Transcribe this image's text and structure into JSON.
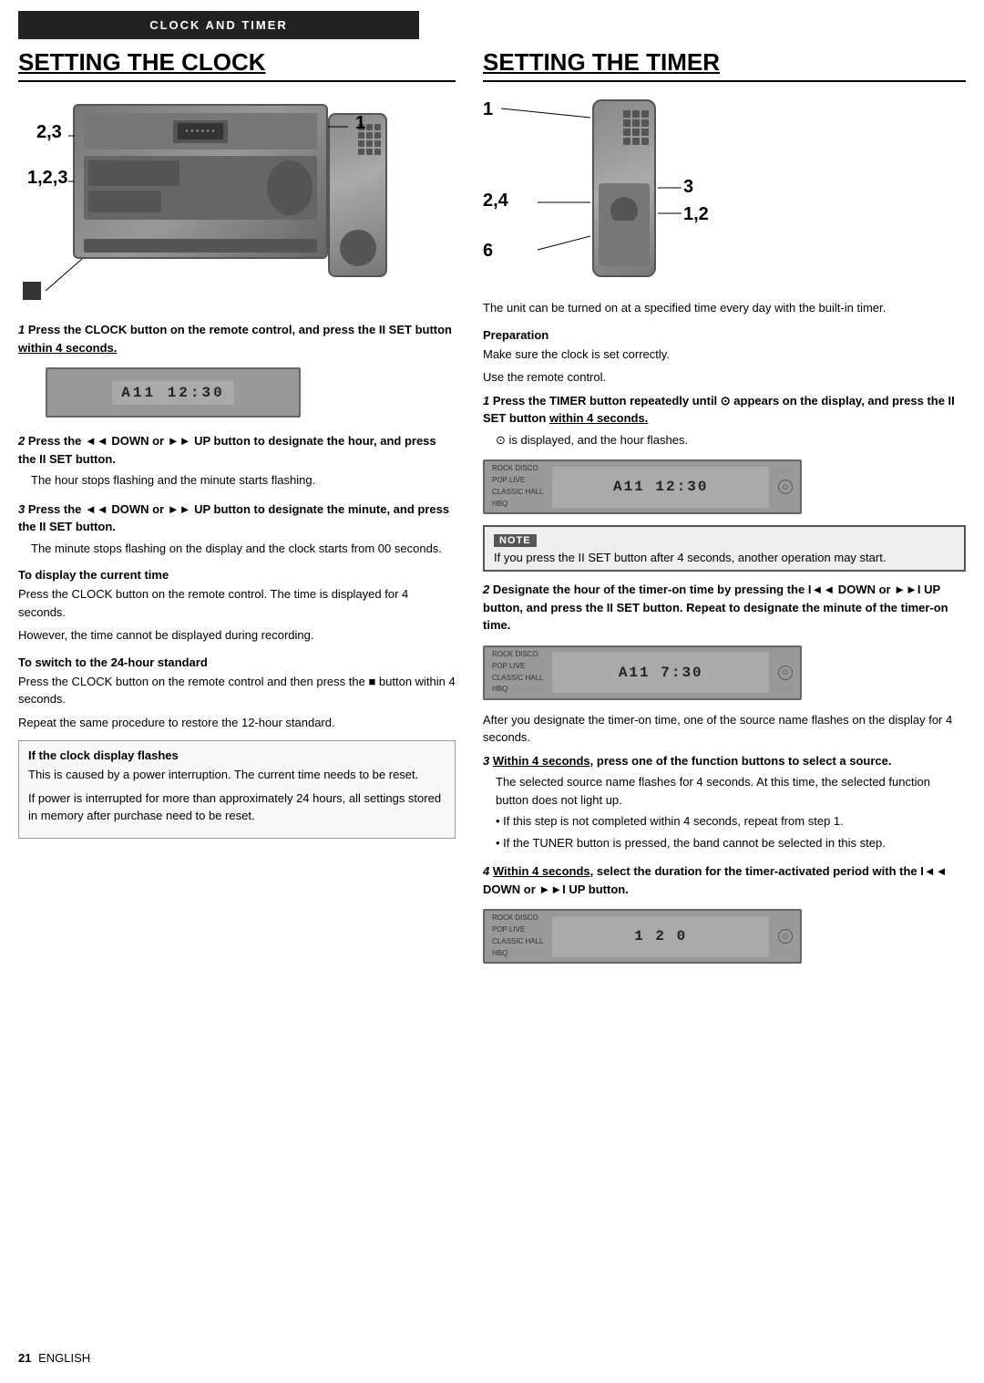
{
  "header": {
    "label": "CLOCK AND TIMER"
  },
  "left": {
    "section_title": "SETTING THE CLOCK",
    "device_labels": {
      "label_23": "2,3",
      "label_123": "1,2,3",
      "label_1": "1"
    },
    "step1": {
      "number": "1",
      "bold_text": "Press the CLOCK button on the remote control, and press the II SET button ",
      "underline_text": "within 4 seconds."
    },
    "display1": "A11 12:30",
    "step2": {
      "number": "2",
      "bold_text": "Press the ◄◄ DOWN or ►► UP button to designate the hour, and press the II SET button.",
      "sub_text": "The hour stops flashing and the minute starts flashing."
    },
    "step3": {
      "number": "3",
      "bold_text": "Press the ◄◄ DOWN or ►► UP button to designate the minute, and press the II SET button.",
      "sub_text": "The minute stops flashing on the display and the clock starts from 00 seconds."
    },
    "subsection1": {
      "title": "To display the current time",
      "text1": "Press the CLOCK button on the remote control.  The time is displayed for 4 seconds.",
      "text2": "However, the time cannot be displayed during recording."
    },
    "subsection2": {
      "title": "To switch to the 24-hour standard",
      "text1": "Press the CLOCK button on the remote control and then press the ■ button within 4 seconds.",
      "text2": "Repeat the same procedure to restore the 12-hour standard."
    },
    "box_note": {
      "title": "If the clock display flashes",
      "text1": "This is caused by a power interruption. The current time needs to be reset.",
      "text2": "If power is interrupted for more than approximately 24 hours, all settings stored in memory after purchase need to be reset."
    }
  },
  "right": {
    "section_title": "SETTING THE TIMER",
    "device_labels": {
      "label_1": "1",
      "label_24": "2,4",
      "label_3": "3",
      "label_12": "1,2",
      "label_6": "6"
    },
    "intro_text": "The unit can be turned on at a specified time every day with the built-in timer.",
    "preparation": {
      "title": "Preparation",
      "text": "Make sure the clock is set correctly."
    },
    "use_remote": "Use the remote control.",
    "step1": {
      "number": "1",
      "bold_text": "Press the TIMER button repeatedly until ⊙ appears on the display, and press the II SET button ",
      "underline_text": "within 4 seconds.",
      "sub_text": "⊙ is displayed, and the hour flashes."
    },
    "note_box": {
      "text": "If you press the II SET button after 4 seconds, another operation may start."
    },
    "step2": {
      "number": "2",
      "bold_text": "Designate the hour of the timer-on time by pressing the I◄◄ DOWN or ►►I UP button, and press the II SET button. Repeat to designate the minute of the timer-on time."
    },
    "display2": "A11  7:30",
    "after_step2_text": "After you designate the timer-on time, one of the source name flashes on the display for 4 seconds.",
    "step3": {
      "number": "3",
      "bold_prefix": "Within 4 seconds,",
      "bold_text": " press one of the function buttons to select a source.",
      "sub_text1": "The selected source name flashes for 4 seconds. At this time, the selected function button does not light up.",
      "bullet1": "If this step is not completed within 4 seconds, repeat from step 1.",
      "bullet2": "If the TUNER button is pressed, the band cannot be selected in this step."
    },
    "step4": {
      "number": "4",
      "bold_prefix": "Within 4 seconds,",
      "bold_text": " select the duration for the timer-activated period with the I◄◄ DOWN or ►►I UP button.",
      "display": "1 2 0"
    }
  },
  "footer": {
    "page_num": "21",
    "lang": "ENGLISH"
  }
}
